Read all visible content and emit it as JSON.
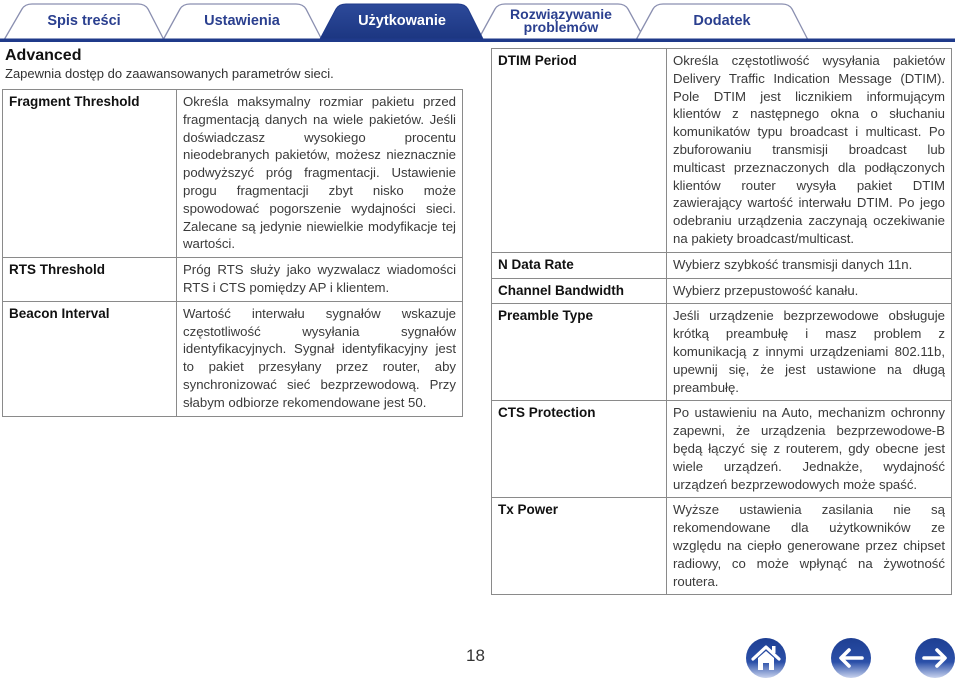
{
  "tabs": [
    {
      "label": "Spis treści",
      "active": false
    },
    {
      "label": "Ustawienia",
      "active": false
    },
    {
      "label": "Użytkowanie",
      "active": true
    },
    {
      "label": "Rozwiązywanie problemów",
      "line1": "Rozwiązywanie",
      "line2": "problemów",
      "active": false
    },
    {
      "label": "Dodatek",
      "active": false
    }
  ],
  "section": {
    "title": "Advanced",
    "subtitle": "Zapewnia dostęp do zaawansowanych parametrów sieci."
  },
  "left_table": [
    {
      "name": "Fragment Threshold",
      "desc": "Określa maksymalny rozmiar pakietu przed fragmentacją danych na wiele pakietów. Jeśli doświadczasz wysokiego procentu nieodebranych pakietów, możesz nieznacznie podwyższyć próg fragmentacji. Ustawienie progu fragmentacji zbyt nisko może spowodować pogorszenie wydajności sieci. Zalecane są jedynie niewielkie modyfikacje tej wartości."
    },
    {
      "name": "RTS Threshold",
      "desc": "Próg RTS służy jako wyzwalacz wiadomości RTS i CTS pomiędzy AP i klientem."
    },
    {
      "name": "Beacon Interval",
      "desc": "Wartość interwału sygnałów wskazuje częstotliwość wysyłania sygnałów identyfikacyjnych. Sygnał identyfikacyjny jest to pakiet przesyłany przez router, aby synchronizować sieć bezprzewodową. Przy słabym odbiorze rekomendowane jest 50."
    }
  ],
  "right_table": [
    {
      "name": "DTIM Period",
      "desc": "Określa częstotliwość wysyłania pakietów Delivery Traffic Indication Message (DTIM). Pole DTIM jest licznikiem informującym klientów z następnego okna o słuchaniu komunikatów typu broadcast i multicast. Po zbuforowaniu transmisji broadcast lub multicast przeznaczonych dla podłączonych klientów router wysyła pakiet DTIM zawierający wartość interwału DTIM. Po jego odebraniu urządzenia zaczynają oczekiwanie na pakiety broadcast/multicast."
    },
    {
      "name": "N Data Rate",
      "desc": "Wybierz szybkość transmisji danych 11n."
    },
    {
      "name": "Channel Bandwidth",
      "desc": "Wybierz przepustowość kanału."
    },
    {
      "name": "Preamble Type",
      "desc": "Jeśli urządzenie bezprzewodowe obsługuje krótką preambułę i masz problem z komunikacją z innymi urządzeniami 802.11b, upewnij się, że jest ustawione na długą preambułę."
    },
    {
      "name": "CTS Protection",
      "desc": "Po ustawieniu na Auto, mechanizm ochronny zapewni, że urządzenia bezprzewodowe-B będą łączyć się z routerem, gdy obecne jest wiele urządzeń. Jednakże, wydajność urządzeń bezprzewodowych może spaść."
    },
    {
      "name": "Tx Power",
      "desc": "Wyższe ustawienia zasilania nie są rekomendowane dla użytkowników ze względu na ciepło generowane przez chipset radiowy, co może wpłynąć na żywotność routera."
    }
  ],
  "footer": {
    "page_number": "18",
    "nav": [
      {
        "icon": "home-icon",
        "label": "Home"
      },
      {
        "icon": "arrow-left-icon",
        "label": "Back"
      },
      {
        "icon": "arrow-right-icon",
        "label": "Forward"
      }
    ]
  },
  "colors": {
    "brand_blue": "#1f3a8a",
    "tab_outline": "#7f86a8",
    "table_border": "#8a8a8a"
  }
}
